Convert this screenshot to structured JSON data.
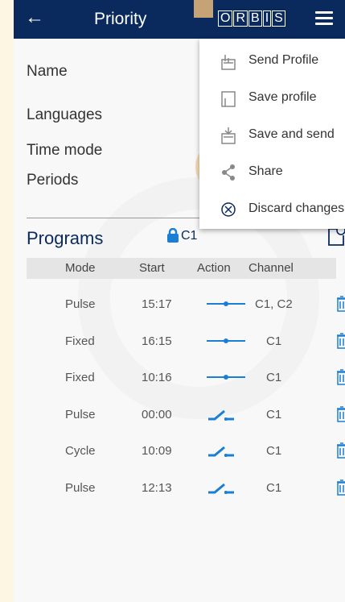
{
  "header": {
    "back_icon": "←",
    "title": "Priority",
    "logo_letters": [
      "O",
      "R",
      "B",
      "I",
      "S"
    ]
  },
  "fields": {
    "name": "Name",
    "languages": "Languages",
    "time_mode": "Time mode",
    "periods": "Periods"
  },
  "programs": {
    "title": "Programs",
    "lock_label": "C1",
    "columns": [
      "Mode",
      "Start",
      "Action",
      "Channel"
    ],
    "rows": [
      {
        "mode": "Pulse",
        "start": "15:17",
        "action": "closed",
        "channel": "C1, C2"
      },
      {
        "mode": "Fixed",
        "start": "16:15",
        "action": "closed",
        "channel": "C1"
      },
      {
        "mode": "Fixed",
        "start": "10:16",
        "action": "closed",
        "channel": "C1"
      },
      {
        "mode": "Pulse",
        "start": "00:00",
        "action": "open",
        "channel": "C1"
      },
      {
        "mode": "Cycle",
        "start": "10:09",
        "action": "open",
        "channel": "C1"
      },
      {
        "mode": "Pulse",
        "start": "12:13",
        "action": "open",
        "channel": "C1"
      }
    ]
  },
  "menu": {
    "items": [
      {
        "label": "Send Profile",
        "icon": "send-profile-icon"
      },
      {
        "label": "Save profile",
        "icon": "save-profile-icon"
      },
      {
        "label": "Save and send",
        "icon": "save-and-send-icon"
      },
      {
        "label": "Share",
        "icon": "share-icon"
      },
      {
        "label": "Discard changes",
        "icon": "discard-icon"
      }
    ]
  },
  "colors": {
    "header": "#0a2a5e",
    "accent": "#1a7fd4",
    "highlight": "#f2d3a4"
  }
}
